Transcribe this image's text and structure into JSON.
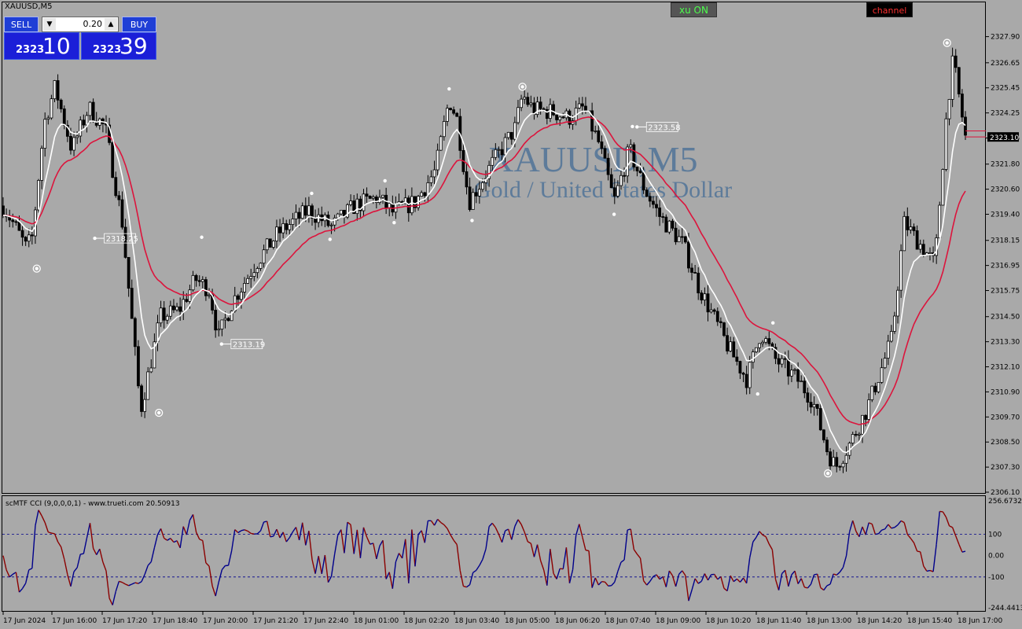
{
  "window": {
    "symbol_label": "XAUUSD,M5"
  },
  "trade_panel": {
    "sell_label": "SELL",
    "buy_label": "BUY",
    "lot_value": "0.20",
    "sell_price_small": "2323",
    "sell_price_big": "10",
    "buy_price_small": "2323",
    "buy_price_big": "39"
  },
  "buttons": {
    "xu_label": "xu ON",
    "channel_label": "channel"
  },
  "watermark": {
    "line1": "XAUUSD,M5",
    "line2": "Gold / United States Dollar"
  },
  "colors": {
    "background": "#a9a9a9",
    "candle": "#000000",
    "fast_ma": "#ffffff",
    "slow_ma": "#dc143c",
    "cci_up": "#00008b",
    "cci_down": "#8b0000",
    "watermark": "#4a6f96",
    "price_tag": "#000000"
  },
  "chart_data": {
    "type": "candlestick",
    "title": "XAUUSD,M5",
    "y_axis": {
      "min": 2306.1,
      "max": 2328.6,
      "ticks": [
        "2327.90",
        "2326.65",
        "2325.45",
        "2324.25",
        "2323.05",
        "2321.80",
        "2320.60",
        "2319.40",
        "2318.15",
        "2316.95",
        "2315.75",
        "2314.50",
        "2313.30",
        "2312.10",
        "2310.90",
        "2309.70",
        "2308.50",
        "2307.30",
        "2306.10"
      ]
    },
    "current_price": "2323.10",
    "price_line_levels": [
      2323.39,
      2323.1
    ],
    "x_axis_ticks": [
      "17 Jun 2024",
      "17 Jun 16:00",
      "17 Jun 17:20",
      "17 Jun 18:40",
      "17 Jun 20:00",
      "17 Jun 21:20",
      "17 Jun 22:40",
      "18 Jun 01:00",
      "18 Jun 02:20",
      "18 Jun 03:40",
      "18 Jun 05:00",
      "18 Jun 06:20",
      "18 Jun 07:40",
      "18 Jun 09:00",
      "18 Jun 10:20",
      "18 Jun 11:40",
      "18 Jun 13:00",
      "18 Jun 14:20",
      "18 Jun 15:40",
      "18 Jun 17:00"
    ],
    "candle_count": 300,
    "price_path": [
      [
        0,
        2319.8
      ],
      [
        8,
        2318.8
      ],
      [
        15,
        2317.8
      ],
      [
        19,
        2318.3
      ],
      [
        27,
        2323.8
      ],
      [
        34,
        2325.5
      ],
      [
        45,
        2322.5
      ],
      [
        56,
        2324.5
      ],
      [
        67,
        2323.5
      ],
      [
        78,
        2319.0
      ],
      [
        90,
        2310.0
      ],
      [
        103,
        2314.5
      ],
      [
        115,
        2314.8
      ],
      [
        126,
        2316.3
      ],
      [
        135,
        2315.8
      ],
      [
        141,
        2313.5
      ],
      [
        150,
        2315.2
      ],
      [
        165,
        2317.0
      ],
      [
        180,
        2318.5
      ],
      [
        200,
        2319.6
      ],
      [
        215,
        2318.8
      ],
      [
        230,
        2319.8
      ],
      [
        245,
        2320.2
      ],
      [
        255,
        2319.5
      ],
      [
        270,
        2320.0
      ],
      [
        283,
        2321.5
      ],
      [
        292,
        2324.9
      ],
      [
        297,
        2324.0
      ],
      [
        305,
        2320.0
      ],
      [
        320,
        2321.8
      ],
      [
        335,
        2323.5
      ],
      [
        340,
        2325.1
      ],
      [
        347,
        2324.4
      ],
      [
        360,
        2324.3
      ],
      [
        370,
        2324.0
      ],
      [
        380,
        2324.5
      ],
      [
        390,
        2322.8
      ],
      [
        400,
        2320.0
      ],
      [
        410,
        2322.5
      ],
      [
        420,
        2320.6
      ],
      [
        430,
        2319.3
      ],
      [
        445,
        2318.0
      ],
      [
        455,
        2316.0
      ],
      [
        465,
        2314.5
      ],
      [
        475,
        2313.0
      ],
      [
        487,
        2311.5
      ],
      [
        496,
        2313.8
      ],
      [
        505,
        2312.5
      ],
      [
        520,
        2311.5
      ],
      [
        530,
        2310.5
      ],
      [
        540,
        2308.0
      ],
      [
        545,
        2307.3
      ],
      [
        555,
        2308.5
      ],
      [
        565,
        2310.0
      ],
      [
        575,
        2312.0
      ],
      [
        582,
        2313.5
      ],
      [
        590,
        2319.0
      ],
      [
        600,
        2318.0
      ],
      [
        610,
        2317.0
      ],
      [
        618,
        2324.5
      ],
      [
        622,
        2326.8
      ],
      [
        630,
        2323.1
      ]
    ],
    "annotations": [
      {
        "label": "2318.25",
        "price": 2318.25,
        "t": 60
      },
      {
        "label": "2313.19",
        "price": 2313.19,
        "t": 143
      },
      {
        "label": "2323.58",
        "price": 2323.58,
        "t": 415
      }
    ],
    "swing_points": [
      {
        "t": 22,
        "price": 2316.8,
        "circled": true
      },
      {
        "t": 102,
        "price": 2309.9,
        "circled": true
      },
      {
        "t": 130,
        "price": 2318.3,
        "circled": false
      },
      {
        "t": 202,
        "price": 2320.4,
        "circled": false
      },
      {
        "t": 214,
        "price": 2318.2,
        "circled": false
      },
      {
        "t": 250,
        "price": 2321.0,
        "circled": false
      },
      {
        "t": 256,
        "price": 2319.0,
        "circled": false
      },
      {
        "t": 292,
        "price": 2325.4,
        "circled": false
      },
      {
        "t": 307,
        "price": 2319.1,
        "circled": false
      },
      {
        "t": 340,
        "price": 2325.5,
        "circled": true
      },
      {
        "t": 400,
        "price": 2319.4,
        "circled": false
      },
      {
        "t": 412,
        "price": 2323.6,
        "circled": false
      },
      {
        "t": 494,
        "price": 2310.8,
        "circled": false
      },
      {
        "t": 504,
        "price": 2314.2,
        "circled": false
      },
      {
        "t": 540,
        "price": 2307.0,
        "circled": true
      },
      {
        "t": 618,
        "price": 2327.6,
        "circled": true
      }
    ],
    "series": [
      {
        "type": "ma_fast"
      },
      {
        "type": "ma_slow"
      }
    ],
    "sub_chart": {
      "title": "scMTF CCI (9,0,0,0,1) - www.trueti.com 20.50913",
      "y_ticks": [
        "256.67323",
        "100",
        "0.00",
        "-100",
        "-244.44134"
      ],
      "y_range": [
        -244.44134,
        256.67323
      ],
      "levels": [
        100,
        -100
      ],
      "last_value": 20.50913
    }
  }
}
